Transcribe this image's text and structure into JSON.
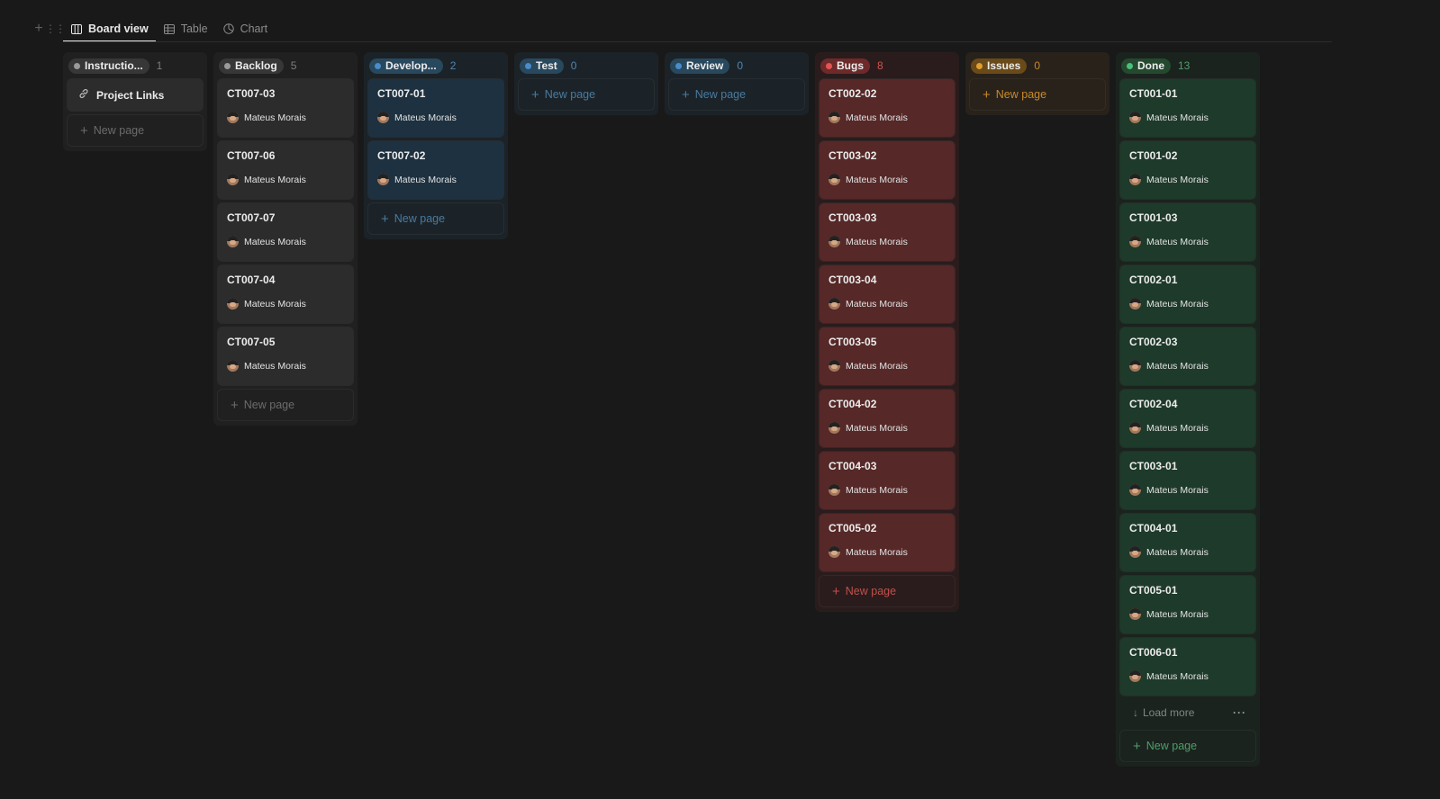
{
  "toolbar": {
    "tabs": [
      {
        "label": "Board view",
        "icon": "board-icon",
        "active": true
      },
      {
        "label": "Table",
        "icon": "table-icon",
        "active": false
      },
      {
        "label": "Chart",
        "icon": "chart-icon",
        "active": false
      }
    ]
  },
  "person": "Mateus Morais",
  "new_page_label": "New page",
  "load_more_label": "Load more",
  "columns": [
    {
      "key": "instructions",
      "label": "Instructio...",
      "count": "1",
      "colors": {
        "col_bg": "#202020",
        "card_bg": "#2c2c2c",
        "pill_bg": "#373737",
        "dot": "#9b9b9b",
        "count": "#7d7d7d",
        "newpage_text": "#6b6b6b"
      },
      "link_card": "Project Links",
      "cards": []
    },
    {
      "key": "backlog",
      "label": "Backlog",
      "count": "5",
      "colors": {
        "col_bg": "#202020",
        "card_bg": "#2c2c2c",
        "pill_bg": "#373737",
        "dot": "#9b9b9b",
        "count": "#7d7d7d",
        "newpage_text": "#6b6b6b"
      },
      "cards": [
        "CT007-03",
        "CT007-06",
        "CT007-07",
        "CT007-04",
        "CT007-05"
      ]
    },
    {
      "key": "development",
      "label": "Develop...",
      "count": "2",
      "colors": {
        "col_bg": "#1b2328",
        "card_bg": "#1d3140",
        "pill_bg": "#28485d",
        "dot": "#4a8cc9",
        "count": "#4f86b3",
        "newpage_text": "#4a7aa0"
      },
      "cards": [
        "CT007-01",
        "CT007-02"
      ]
    },
    {
      "key": "test",
      "label": "Test",
      "count": "0",
      "colors": {
        "col_bg": "#1b2328",
        "card_bg": "#1d3140",
        "pill_bg": "#28485d",
        "dot": "#4a8cc9",
        "count": "#4f86b3",
        "newpage_text": "#4a7aa0"
      },
      "cards": []
    },
    {
      "key": "review",
      "label": "Review",
      "count": "0",
      "colors": {
        "col_bg": "#1b2328",
        "card_bg": "#1d3140",
        "pill_bg": "#28485d",
        "dot": "#4a8cc9",
        "count": "#4f86b3",
        "newpage_text": "#4a7aa0"
      },
      "cards": []
    },
    {
      "key": "bugs",
      "label": "Bugs",
      "count": "8",
      "colors": {
        "col_bg": "#2a1c1c",
        "card_bg": "#562828",
        "pill_bg": "#6e2a2a",
        "dot": "#e25555",
        "count": "#d2534e",
        "newpage_text": "#c0504c"
      },
      "cards": [
        "CT002-02",
        "CT003-02",
        "CT003-03",
        "CT003-04",
        "CT003-05",
        "CT004-02",
        "CT004-03",
        "CT005-02"
      ]
    },
    {
      "key": "issues",
      "label": "Issues",
      "count": "0",
      "colors": {
        "col_bg": "#28221b",
        "card_bg": "#3b2e1e",
        "pill_bg": "#6a4a18",
        "dot": "#e0a030",
        "count": "#c9892a",
        "newpage_text": "#c9892a"
      },
      "cards": []
    },
    {
      "key": "done",
      "label": "Done",
      "count": "13",
      "colors": {
        "col_bg": "#1b231e",
        "card_bg": "#1e3a2a",
        "pill_bg": "#24492f",
        "dot": "#4ac07a",
        "count": "#4f9d6a",
        "newpage_text": "#4f9d6a"
      },
      "cards": [
        "CT001-01",
        "CT001-02",
        "CT001-03",
        "CT002-01",
        "CT002-03",
        "CT002-04",
        "CT003-01",
        "CT004-01",
        "CT005-01",
        "CT006-01"
      ],
      "load_more": true
    }
  ]
}
